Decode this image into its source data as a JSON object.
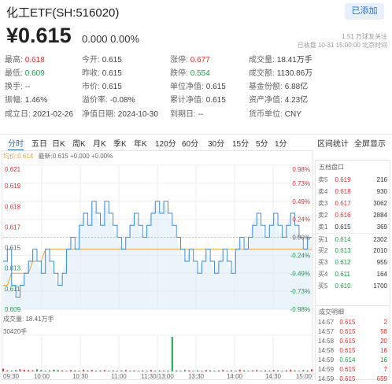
{
  "header": {
    "title": "化工ETF(SH:516020)",
    "follow_label": "已添加",
    "price": "¥0.615",
    "change": "0.000 0.00%",
    "followers": "1.51 万球友关注",
    "status_line": "已收盘 10-31 15:00:00 北京时间"
  },
  "stats": [
    {
      "k": "最高:",
      "v": "0.618",
      "c": "red"
    },
    {
      "k": "今开:",
      "v": "0.615",
      "c": ""
    },
    {
      "k": "涨停:",
      "v": "0.677",
      "c": "red"
    },
    {
      "k": "成交量:",
      "v": "18.41万手",
      "c": ""
    },
    {
      "k": "最低:",
      "v": "0.609",
      "c": "green"
    },
    {
      "k": "昨收:",
      "v": "0.615",
      "c": ""
    },
    {
      "k": "跌停:",
      "v": "0.554",
      "c": "green"
    },
    {
      "k": "成交额:",
      "v": "1130.86万",
      "c": ""
    },
    {
      "k": "换手:",
      "v": "--",
      "c": ""
    },
    {
      "k": "市价:",
      "v": "0.615",
      "c": ""
    },
    {
      "k": "单位净值:",
      "v": "0.615",
      "c": ""
    },
    {
      "k": "基金份额:",
      "v": "6.88亿",
      "c": ""
    },
    {
      "k": "振幅:",
      "v": "1.46%",
      "c": ""
    },
    {
      "k": "溢价率:",
      "v": "-0.08%",
      "c": ""
    },
    {
      "k": "累计净值:",
      "v": "0.615",
      "c": ""
    },
    {
      "k": "资产净值:",
      "v": "4.23亿",
      "c": ""
    },
    {
      "k": "成立日:",
      "v": "2021-02-26",
      "c": ""
    },
    {
      "k": "净值日期:",
      "v": "2024-10-30",
      "c": ""
    },
    {
      "k": "到期日:",
      "v": "--",
      "c": ""
    },
    {
      "k": "货币单位:",
      "v": "CNY",
      "c": ""
    }
  ],
  "tabs": [
    "分时",
    "五日",
    "日K",
    "周K",
    "月K",
    "季K",
    "年K",
    "120分",
    "60分",
    "30分",
    "15分",
    "5分",
    "1分"
  ],
  "tab_links": {
    "stats": "区间统计",
    "fullscreen": "全屏显示"
  },
  "legend": {
    "avg": "均价:0.614",
    "latest": "最新:0.615 +0.000 +0.00%"
  },
  "volume_label": "成交量: 18.41万手",
  "volume_max": "30420手",
  "orderbook_title": "五档盘口",
  "trades_title": "成交明细",
  "orderbook": [
    {
      "label": "卖5",
      "price": "0.619",
      "vol": "216",
      "c": "red"
    },
    {
      "label": "卖4",
      "price": "0.618",
      "vol": "930",
      "c": "red"
    },
    {
      "label": "卖3",
      "price": "0.617",
      "vol": "3062",
      "c": "red"
    },
    {
      "label": "卖2",
      "price": "0.616",
      "vol": "2884",
      "c": "red"
    },
    {
      "label": "卖1",
      "price": "0.615",
      "vol": "369",
      "c": ""
    },
    {
      "label": "买1",
      "price": "0.614",
      "vol": "2302",
      "c": "green"
    },
    {
      "label": "买2",
      "price": "0.613",
      "vol": "2010",
      "c": "green"
    },
    {
      "label": "买3",
      "price": "0.612",
      "vol": "955",
      "c": "green"
    },
    {
      "label": "买4",
      "price": "0.611",
      "vol": "164",
      "c": "green"
    },
    {
      "label": "买5",
      "price": "0.610",
      "vol": "1700",
      "c": "green"
    }
  ],
  "trades": [
    {
      "time": "14:57",
      "price": "0.615",
      "vol": "2",
      "c": "red"
    },
    {
      "time": "14:57",
      "price": "0.615",
      "vol": "58",
      "c": "red"
    },
    {
      "time": "14:58",
      "price": "0.615",
      "vol": "20",
      "c": "red"
    },
    {
      "time": "14:58",
      "price": "0.615",
      "vol": "16",
      "c": "red"
    },
    {
      "time": "14:59",
      "price": "0.614",
      "vol": "16",
      "c": "green"
    },
    {
      "time": "14:59",
      "price": "0.615",
      "vol": "7",
      "c": "red"
    },
    {
      "time": "14:59",
      "price": "0.615",
      "vol": "659",
      "c": "red"
    }
  ],
  "chart_data": {
    "type": "line",
    "y_left_ticks": [
      "0.621",
      "0.619",
      "0.618",
      "0.617",
      "0.615",
      "0.613",
      "0.611",
      "0.609"
    ],
    "y_right_ticks": [
      "0.98%",
      "0.73%",
      "0.49%",
      "0.24%",
      "0.00%",
      "-0.24%",
      "-0.49%",
      "-0.73%",
      "-0.98%"
    ],
    "x_ticks": [
      "09:30",
      "10:00",
      "10:30",
      "11:00",
      "11:30/13:00",
      "13:30",
      "14:00",
      "14:30",
      "15:00"
    ],
    "ylim": [
      0.609,
      0.621
    ],
    "prev_close": 0.615,
    "price_series": [
      0.613,
      0.614,
      0.611,
      0.61,
      0.611,
      0.612,
      0.613,
      0.614,
      0.613,
      0.612,
      0.614,
      0.613,
      0.612,
      0.611,
      0.612,
      0.614,
      0.615,
      0.614,
      0.616,
      0.617,
      0.616,
      0.618,
      0.617,
      0.616,
      0.618,
      0.617,
      0.616,
      0.615,
      0.614,
      0.615,
      0.616,
      0.617,
      0.616,
      0.615,
      0.616,
      0.617,
      0.618,
      0.617,
      0.618,
      0.617,
      0.616,
      0.615,
      0.614,
      0.613,
      0.614,
      0.613,
      0.612,
      0.613,
      0.614,
      0.613,
      0.612,
      0.613,
      0.614,
      0.613,
      0.612,
      0.614,
      0.615,
      0.614,
      0.615,
      0.616,
      0.617,
      0.616,
      0.615,
      0.616,
      0.617,
      0.616,
      0.615,
      0.616,
      0.617,
      0.616,
      0.615,
      0.614,
      0.615,
      0.615
    ],
    "avg_series": [
      0.611,
      0.611,
      0.612,
      0.612,
      0.612,
      0.612,
      0.612,
      0.613,
      0.613,
      0.613,
      0.614,
      0.614,
      0.614,
      0.614,
      0.614,
      0.614,
      0.614,
      0.614,
      0.614,
      0.614,
      0.614,
      0.614,
      0.614,
      0.614,
      0.614,
      0.614,
      0.614,
      0.614,
      0.614,
      0.614,
      0.614,
      0.614,
      0.614,
      0.614,
      0.614,
      0.614,
      0.614,
      0.614,
      0.614,
      0.614,
      0.614,
      0.614,
      0.614,
      0.614,
      0.614,
      0.614,
      0.614,
      0.614,
      0.614,
      0.614,
      0.614,
      0.614,
      0.614,
      0.614,
      0.614,
      0.614,
      0.614,
      0.614,
      0.614,
      0.614,
      0.614,
      0.614,
      0.614,
      0.614,
      0.614,
      0.614,
      0.614,
      0.614,
      0.614,
      0.614,
      0.614,
      0.614,
      0.614,
      0.614
    ],
    "volume_series": [
      8,
      3,
      2,
      4,
      6,
      5,
      4,
      3,
      6,
      4,
      2,
      3,
      5,
      4,
      3,
      2,
      4,
      3,
      2,
      5,
      3,
      4,
      2,
      3,
      4,
      2,
      3,
      2,
      3,
      4,
      2,
      3,
      2,
      3,
      2,
      4,
      2,
      3,
      2,
      3,
      100,
      3,
      2,
      4,
      3,
      2,
      3,
      2,
      4,
      3,
      2,
      3,
      4,
      2,
      3,
      2,
      5,
      3,
      2,
      3,
      4,
      2,
      3,
      2,
      4,
      3,
      2,
      3,
      5,
      3,
      2,
      4,
      3,
      6
    ],
    "volume_max": 30420,
    "up_color": "#e93030",
    "down_color": "#1aa34a",
    "line_color": "#3a8ee6",
    "avg_color": "#f0a030"
  }
}
